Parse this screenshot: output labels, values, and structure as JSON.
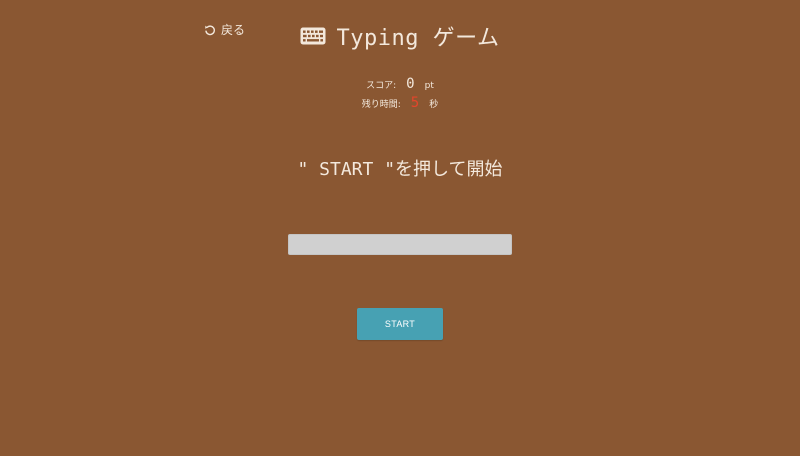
{
  "header": {
    "back_label": "戻る",
    "back_icon": "undo-arrow-icon",
    "title_icon": "keyboard-icon",
    "title": "Typing ゲーム"
  },
  "stats": {
    "score_label": "スコア:",
    "score_value": "0",
    "score_unit": "pt",
    "time_label": "残り時間:",
    "time_value": "5",
    "time_unit": "秒"
  },
  "game": {
    "prompt": "\" START \"を押して開始",
    "input_value": "",
    "input_placeholder": "",
    "start_label": "START"
  },
  "colors": {
    "background": "#8a5732",
    "text": "#f3e8dc",
    "time_value": "#e4452b",
    "input_background": "#d0d0d0",
    "start_button": "#47a1b3"
  }
}
